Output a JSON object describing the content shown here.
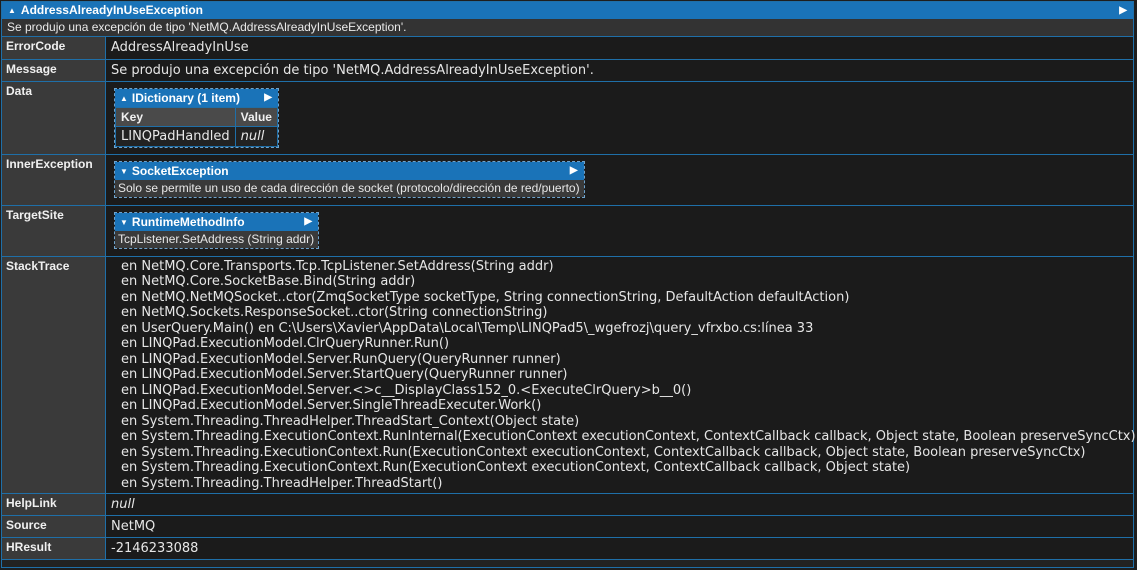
{
  "exception": {
    "type_name": "AddressAlreadyInUseException",
    "summary": "Se produjo una excepción de tipo 'NetMQ.AddressAlreadyInUseException'."
  },
  "fields": {
    "error_code": {
      "key": "ErrorCode",
      "value": "AddressAlreadyInUse"
    },
    "message": {
      "key": "Message",
      "value": "Se produjo una excepción de tipo 'NetMQ.AddressAlreadyInUseException'."
    },
    "data": {
      "key": "Data",
      "box_title": "IDictionary (1 item)",
      "columns": [
        "Key",
        "Value"
      ],
      "row": {
        "key": "LINQPadHandled",
        "value": "null"
      }
    },
    "inner_exception": {
      "key": "InnerException",
      "box_title": "SocketException",
      "box_text": "Solo se permite un uso de cada dirección de socket (protocolo/dirección de red/puerto)"
    },
    "target_site": {
      "key": "TargetSite",
      "box_title": "RuntimeMethodInfo",
      "box_text": "TcpListener.SetAddress (String addr)"
    },
    "stack_trace": {
      "key": "StackTrace",
      "lines": [
        "en NetMQ.Core.Transports.Tcp.TcpListener.SetAddress(String addr)",
        "en NetMQ.Core.SocketBase.Bind(String addr)",
        "en NetMQ.NetMQSocket..ctor(ZmqSocketType socketType, String connectionString, DefaultAction defaultAction)",
        "en NetMQ.Sockets.ResponseSocket..ctor(String connectionString)",
        "en UserQuery.Main() en C:\\Users\\Xavier\\AppData\\Local\\Temp\\LINQPad5\\_wgefrozj\\query_vfrxbo.cs:línea 33",
        "en LINQPad.ExecutionModel.ClrQueryRunner.Run()",
        "en LINQPad.ExecutionModel.Server.RunQuery(QueryRunner runner)",
        "en LINQPad.ExecutionModel.Server.StartQuery(QueryRunner runner)",
        "en LINQPad.ExecutionModel.Server.<>c__DisplayClass152_0.<ExecuteClrQuery>b__0()",
        "en LINQPad.ExecutionModel.Server.SingleThreadExecuter.Work()",
        "en System.Threading.ThreadHelper.ThreadStart_Context(Object state)",
        "en System.Threading.ExecutionContext.RunInternal(ExecutionContext executionContext, ContextCallback callback, Object state, Boolean preserveSyncCtx)",
        "en System.Threading.ExecutionContext.Run(ExecutionContext executionContext, ContextCallback callback, Object state, Boolean preserveSyncCtx)",
        "en System.Threading.ExecutionContext.Run(ExecutionContext executionContext, ContextCallback callback, Object state)",
        "en System.Threading.ThreadHelper.ThreadStart()"
      ]
    },
    "help_link": {
      "key": "HelpLink",
      "value": "null"
    },
    "source": {
      "key": "Source",
      "value": "NetMQ"
    },
    "hresult": {
      "key": "HResult",
      "value": "-2146233088"
    }
  },
  "icons": {
    "collapse": "triangle-up-icon",
    "expand": "triangle-down-icon",
    "navigate": "arrow-right-icon"
  },
  "colors": {
    "header_blue": "#1a73b8",
    "null_green": "#7cdc2e",
    "background": "#1b1b1b"
  }
}
